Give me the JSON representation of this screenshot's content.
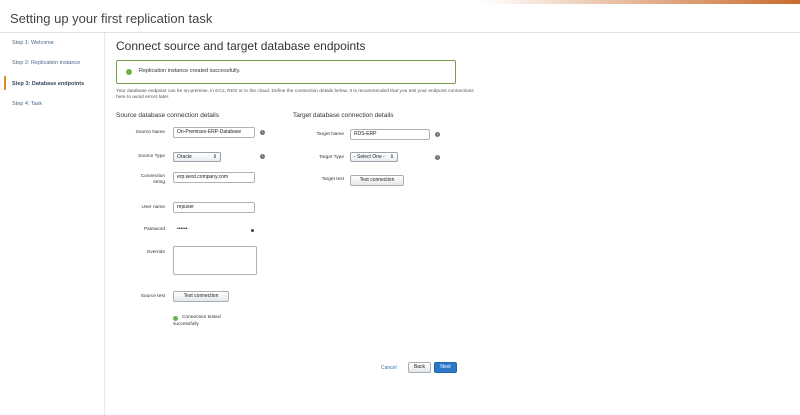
{
  "page": {
    "title": "Setting up your first replication task"
  },
  "sidebar": {
    "steps": [
      {
        "label": "Step 1: Welcome"
      },
      {
        "label": "Step 2: Replication instance"
      },
      {
        "label": "Step 3: Database endpoints"
      },
      {
        "label": "Step 4: Task"
      }
    ]
  },
  "main": {
    "title": "Connect source and target database endpoints",
    "alert": "Replication instance created successfully.",
    "intro": "Your database endpoint can be on-premise, in EC2, RDS or in the cloud. Define the connection details below. It is recommended that you test your endpoint connections here to avoid errors later."
  },
  "source": {
    "heading": "Source database connection details",
    "name_label": "Source Name",
    "name_value": "On-Premises-ERP-Database",
    "type_label": "Source Type",
    "type_value": "Oracle",
    "conn_label_1": "Connection",
    "conn_label_2": "string",
    "conn_value": "erp.west.company.com",
    "user_label": "User name",
    "user_value": "repuser",
    "pass_label": "Password",
    "pass_value": "••••••",
    "override_label": "Override",
    "test_label": "Source test",
    "test_button": "Test connection",
    "status_line1": "Connection tested",
    "status_line2": "successfully"
  },
  "target": {
    "heading": "Target database connection details",
    "name_label": "Target Name",
    "name_value": "RDS-ERP",
    "type_label": "Target Type",
    "type_value": "- Select One -",
    "test_label": "Target test",
    "test_button": "Test connection"
  },
  "footer": {
    "cancel": "Cancel",
    "back": "Back",
    "next": "Next"
  },
  "colors": {
    "accent": "#e08a2e",
    "primary": "#2d79c7",
    "success": "#6ab04c"
  }
}
